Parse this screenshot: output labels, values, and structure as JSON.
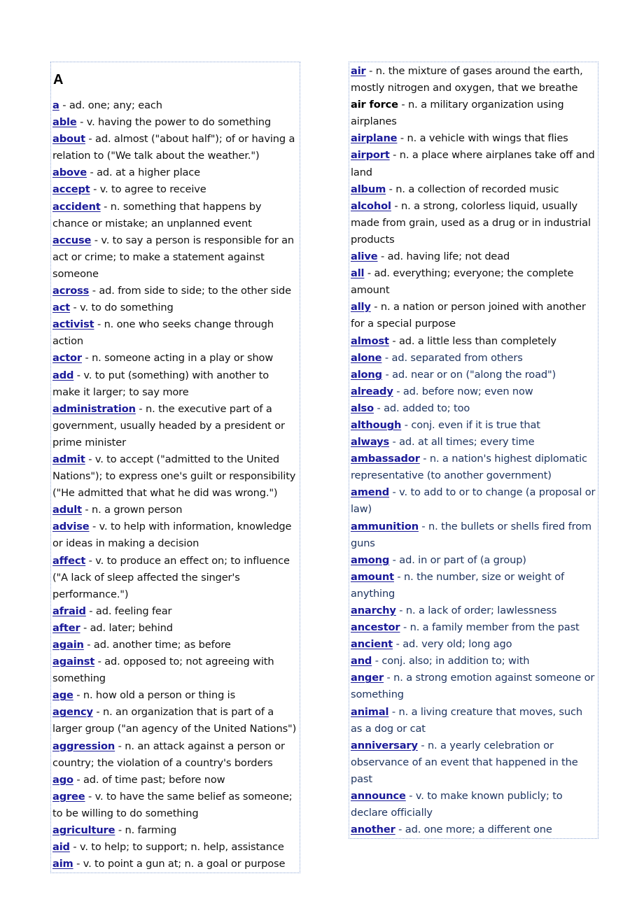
{
  "heading": "A",
  "left_entries": [
    {
      "word": "a",
      "def": "ad. one; any; each"
    },
    {
      "word": "able",
      "def": "v. having the power to do something"
    },
    {
      "word": "about",
      "def": "ad. almost (\"about half\"); of or having a relation to (\"We talk about the weather.\")"
    },
    {
      "word": "above",
      "def": "ad. at a higher place"
    },
    {
      "word": "accept",
      "def": "v. to agree to receive"
    },
    {
      "word": "accident",
      "def": "n. something that happens by chance or mistake; an unplanned event"
    },
    {
      "word": "accuse",
      "def": "v. to say a person is responsible for an act or crime; to make a statement against someone"
    },
    {
      "word": "across",
      "def": "ad. from side to side; to the other side"
    },
    {
      "word": "act",
      "def": "v. to do something"
    },
    {
      "word": "activist",
      "def": "n. one who seeks change through action"
    },
    {
      "word": "actor",
      "def": "n. someone acting in a play or show"
    },
    {
      "word": "add",
      "def": "v. to put (something) with another to make it larger; to say more"
    },
    {
      "word": "administration",
      "def": "n. the executive part of a government, usually headed by a president or prime minister"
    },
    {
      "word": "admit",
      "def": "v. to accept (\"admitted to the United Nations\"); to express one's guilt or responsibility (\"He admitted that what he did was wrong.\")"
    },
    {
      "word": "adult",
      "def": "n. a grown person"
    },
    {
      "word": "advise",
      "def": "v. to help with information, knowledge or ideas in making a decision"
    },
    {
      "word": "affect",
      "def": "v. to produce an effect on; to influence (\"A lack of sleep affected the singer's performance.\")"
    },
    {
      "word": "afraid",
      "def": "ad. feeling fear"
    },
    {
      "word": "after",
      "def": "ad. later; behind"
    },
    {
      "word": "again",
      "def": "ad. another time; as before"
    },
    {
      "word": "against",
      "def": "ad. opposed to; not agreeing with something"
    },
    {
      "word": "age",
      "def": "n. how old a person or thing is"
    },
    {
      "word": "agency",
      "def": "n. an organization that is part of a larger group (\"an agency of the United Nations\")"
    },
    {
      "word": "aggression",
      "def": "n. an attack against a person or country; the violation of a country's borders"
    },
    {
      "word": "ago",
      "def": "ad. of time past; before now"
    },
    {
      "word": "agree",
      "def": "v. to have the same belief as someone; to be willing to do something"
    },
    {
      "word": "agriculture",
      "def": "n. farming"
    },
    {
      "word": "aid",
      "def": "v. to help; to support; n. help, assistance"
    },
    {
      "word": "aim",
      "def": "v. to point a gun at; n. a goal or purpose"
    }
  ],
  "right_entries": [
    {
      "word": "air",
      "def": "n. the mixture of gases around the earth, mostly nitrogen and oxygen, that we breathe"
    },
    {
      "word": "air force",
      "def": "n. a military organization using airplanes",
      "plain": true
    },
    {
      "word": "airplane",
      "def": "n. a vehicle with wings that flies"
    },
    {
      "word": "airport",
      "def": "n. a place where airplanes take off and land"
    },
    {
      "word": "album",
      "def": "n. a collection of recorded music"
    },
    {
      "word": "alcohol",
      "def": "n. a strong, colorless liquid, usually made from grain, used as a drug or in industrial products"
    },
    {
      "word": "alive",
      "def": "ad. having life; not dead"
    },
    {
      "word": "all",
      "def": "ad. everything; everyone; the complete amount"
    },
    {
      "word": "ally",
      "def": "n. a nation or person joined with another for a special purpose"
    },
    {
      "word": "almost",
      "def": "ad. a little less than completely"
    },
    {
      "word": "alone",
      "def": "ad. separated from others",
      "navy": true
    },
    {
      "word": "along",
      "def": "ad. near or on (\"along the road\")",
      "navy": true
    },
    {
      "word": "already",
      "def": "ad. before now; even now",
      "navy": true
    },
    {
      "word": "also",
      "def": "ad. added to; too",
      "navy": true
    },
    {
      "word": "although",
      "def": "conj. even if it is true that",
      "navy": true
    },
    {
      "word": "always",
      "def": "ad. at all times; every time",
      "navy": true
    },
    {
      "word": "ambassador",
      "def": "n. a nation's highest diplomatic representative (to another government)",
      "navy": true
    },
    {
      "word": "amend",
      "def": "v. to add to or to change (a proposal or law)",
      "navy": true
    },
    {
      "word": "ammunition",
      "def": "n. the bullets or shells fired from guns",
      "navy": true
    },
    {
      "word": "among",
      "def": "ad. in or part of (a group)",
      "navy": true
    },
    {
      "word": "amount",
      "def": "n. the number, size or weight of anything",
      "navy": true
    },
    {
      "word": "anarchy",
      "def": "n. a lack of order; lawlessness",
      "navy": true
    },
    {
      "word": "ancestor",
      "def": "n. a family member from the past",
      "navy": true
    },
    {
      "word": "ancient",
      "def": "ad. very old; long ago",
      "navy": true
    },
    {
      "word": "and",
      "def": "conj. also; in addition to; with",
      "navy": true
    },
    {
      "word": "anger",
      "def": "n. a strong emotion against someone or something",
      "navy": true
    },
    {
      "word": "animal",
      "def": "n. a living creature that moves, such as a dog or cat",
      "navy": true
    },
    {
      "word": "anniversary",
      "def": "n. a yearly celebration or observance of an event that happened in the past",
      "navy": true
    },
    {
      "word": "announce",
      "def": "v. to make known publicly; to declare officially",
      "navy": true
    },
    {
      "word": "another",
      "def": "ad. one more; a different one",
      "navy": true
    }
  ],
  "separator": " - ",
  "colors": {
    "link": "#1a1a99",
    "text": "#111111",
    "navy_text": "#1f3560",
    "border": "#8fa8d6"
  }
}
